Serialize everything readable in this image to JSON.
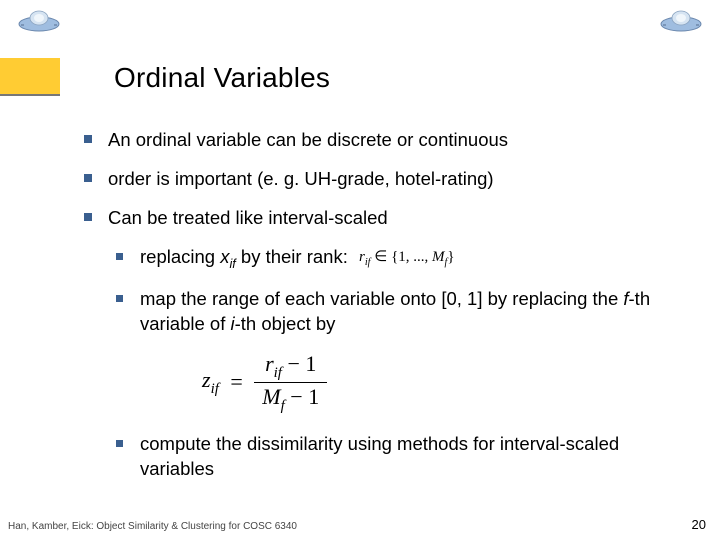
{
  "title": "Ordinal Variables",
  "bullets": {
    "b1": "An ordinal variable can be discrete or continuous",
    "b2": "order is important (e. g. UH-grade, hotel-rating)",
    "b3": "Can be treated like interval-scaled",
    "b3a_prefix": "replacing ",
    "b3a_var_x": "x",
    "b3a_var_sub": "if",
    "b3a_suffix": "  by their rank:",
    "b3a_rank_r": "r",
    "b3a_rank_sub": "if",
    "b3a_rank_set_open": "∈ {1, ..., ",
    "b3a_rank_M": "M",
    "b3a_rank_Msub": "f",
    "b3a_rank_close": "}",
    "b3b_prefix": "map the range of each variable onto [0, 1] by replacing the ",
    "b3b_f": "f",
    "b3b_mid": "-th variable of ",
    "b3b_i": "i",
    "b3b_suffix": "-th object by",
    "formula_z": "z",
    "formula_zsub": "if",
    "formula_eq": "=",
    "formula_num_r": "r",
    "formula_num_sub": "if",
    "formula_num_minus": " − 1",
    "formula_den_M": "M",
    "formula_den_sub": "f",
    "formula_den_minus": " − 1",
    "b3c": "compute the dissimilarity using methods for interval-scaled variables"
  },
  "footer": {
    "left": "Han, Kamber, Eick: Object Similarity & Clustering for COSC 6340",
    "right": "20"
  }
}
